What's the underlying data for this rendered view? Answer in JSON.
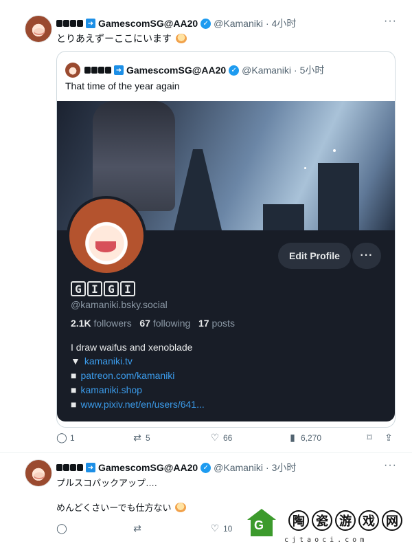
{
  "tweet1": {
    "user_display": "GamescomSG@AA20",
    "handle": "@Kamaniki",
    "dot": "·",
    "time": "4小时",
    "text": "とりあえずーここにいます",
    "more": "···"
  },
  "quote": {
    "user_display": "GamescomSG@AA20",
    "handle": "@Kamaniki",
    "dot": "·",
    "time": "5小时",
    "text": "That time of the year again",
    "profile": {
      "edit_label": "Edit Profile",
      "more_label": "···",
      "name_chars": [
        "G",
        "I",
        "G",
        "I"
      ],
      "handle": "@kamaniki.bsky.social",
      "followers_count": "2.1K",
      "followers_label": " followers",
      "following_count": "67",
      "following_label": " following",
      "posts_count": "17",
      "posts_label": " posts",
      "bio": "I draw waifus and xenoblade",
      "links": [
        {
          "bullet": "▼",
          "text": "kamaniki.tv"
        },
        {
          "bullet": "■",
          "text": "patreon.com/kamaniki"
        },
        {
          "bullet": "■",
          "text": "kamaniki.shop"
        },
        {
          "bullet": "■",
          "text": "www.pixiv.net/en/users/641..."
        }
      ]
    }
  },
  "tweet1_actions": {
    "replies": "1",
    "retweets": "5",
    "likes": "66",
    "views": "6,270"
  },
  "tweet2": {
    "user_display": "GamescomSG@AA20",
    "handle": "@Kamaniki",
    "dot": "·",
    "time": "3小时",
    "line1": "プルスコパックアップ….",
    "line2": "めんどくさいーでも仕方ない",
    "more": "···"
  },
  "tweet2_actions": {
    "likes": "10"
  },
  "watermark": {
    "chars": [
      "陶",
      "瓷",
      "游",
      "戏",
      "网"
    ],
    "url": "cjtaoci.com"
  },
  "icons": {
    "verified": "verified-badge-icon",
    "reply": "reply-icon",
    "retweet": "retweet-icon",
    "like": "like-icon",
    "views": "views-icon",
    "bookmark": "bookmark-icon",
    "share": "share-icon"
  }
}
